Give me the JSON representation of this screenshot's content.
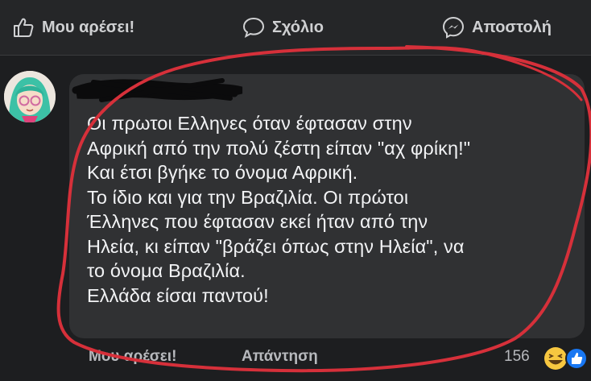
{
  "actions": {
    "like_label": "Μου αρέσει!",
    "comment_label": "Σχόλιο",
    "share_label": "Αποστολή"
  },
  "comment": {
    "author": "",
    "text": "Οι πρωτοι Ελληνες όταν έφτασαν στην\nΑφρική από την πολύ ζέστη είπαν \"αχ φρίκη!\"\nΚαι  έτσι βγήκε το όνομα Αφρική.\nΤο ίδιο και για την Βραζιλία. Οι πρώτοι\nΈλληνες που έφτασαν εκεί ήταν από την\nΗλεία, κι είπαν \"βράζει όπως στην Ηλεία\", να\nτο όνομα Βραζιλία.\nΕλλάδα είσαι παντού!"
  },
  "footer": {
    "like_label": "Μου αρέσει!",
    "reply_label": "Απάντηση",
    "reaction_count": "156"
  },
  "icons": {
    "like": "thumbs-up-icon",
    "comment": "speech-bubble-icon",
    "share": "messenger-icon",
    "reactions": [
      "haha-emoji-icon",
      "like-reaction-icon"
    ]
  },
  "colors": {
    "annotation": "#d6303a",
    "like_reaction": "#1877f2",
    "haha_reaction": "#f7c740"
  }
}
